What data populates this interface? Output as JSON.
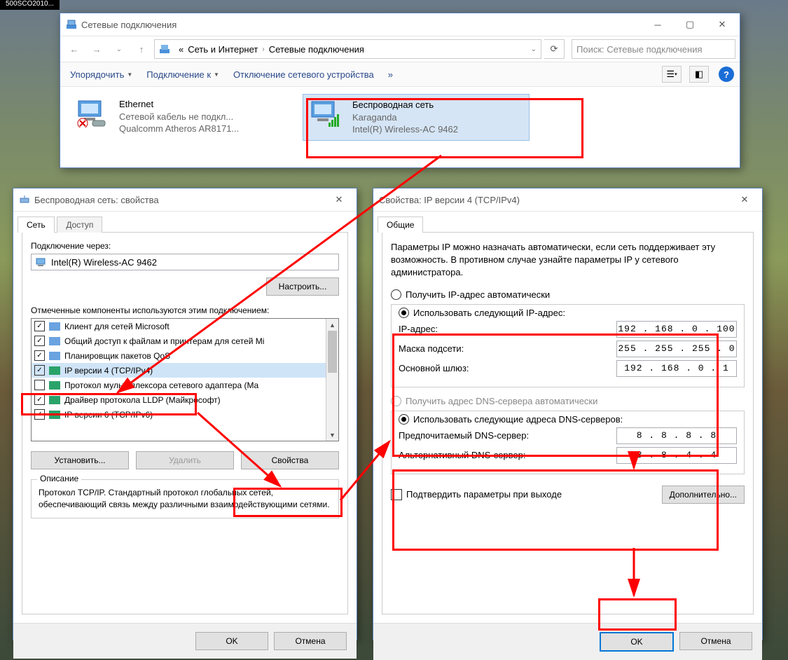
{
  "taskbar": "500SCO2010...",
  "explorer": {
    "title": "Сетевые подключения",
    "addr": {
      "root": "«",
      "p1": "Сеть и Интернет",
      "p2": "Сетевые подключения"
    },
    "search_placeholder": "Поиск: Сетевые подключения",
    "cmd": {
      "organize": "Упорядочить",
      "connect": "Подключение к",
      "disable": "Отключение сетевого устройства",
      "more": "»"
    },
    "conn": [
      {
        "name": "Ethernet",
        "status": "Сетевой кабель не подкл...",
        "adapter": "Qualcomm Atheros AR8171..."
      },
      {
        "name": "Беспроводная сеть",
        "status": "Karaganda",
        "adapter": "Intel(R) Wireless-AC 9462"
      }
    ]
  },
  "props": {
    "title": "Беспроводная сеть: свойства",
    "tabs": {
      "net": "Сеть",
      "access": "Доступ"
    },
    "conn_via_label": "Подключение через:",
    "adapter": "Intel(R) Wireless-AC 9462",
    "configure": "Настроить...",
    "components_label": "Отмеченные компоненты используются этим подключением:",
    "items": [
      "Клиент для сетей Microsoft",
      "Общий доступ к файлам и принтерам для сетей Mi",
      "Планировщик пакетов QoS",
      "IP версии 4 (TCP/IPv4)",
      "Протокол мультиплексора сетевого адаптера (Ma",
      "Драйвер протокола LLDP (Майкрософт)",
      "IP версии 6 (TCP/IPv6)"
    ],
    "item4_unchecked": true,
    "btn_install": "Установить...",
    "btn_remove": "Удалить",
    "btn_props": "Свойства",
    "desc_title": "Описание",
    "desc": "Протокол TCP/IP. Стандартный протокол глобальных сетей, обеспечивающий связь между различными взаимодействующими сетями.",
    "ok": "OK",
    "cancel": "Отмена"
  },
  "ipv4": {
    "title": "Свойства: IP версии 4 (TCP/IPv4)",
    "tab": "Общие",
    "intro": "Параметры IP можно назначать автоматически, если сеть поддерживает эту возможность. В противном случае узнайте параметры IP у сетевого администратора.",
    "r_auto_ip": "Получить IP-адрес автоматически",
    "r_use_ip": "Использовать следующий IP-адрес:",
    "l_ip": "IP-адрес:",
    "v_ip": "192 . 168 .  0  . 100",
    "l_mask": "Маска подсети:",
    "v_mask": "255 . 255 . 255 .  0",
    "l_gw": "Основной шлюз:",
    "v_gw": "192 . 168 .  0  .  1",
    "r_auto_dns": "Получить адрес DNS-сервера автоматически",
    "r_use_dns": "Использовать следующие адреса DNS-серверов:",
    "l_dns1": "Предпочитаемый DNS-сервер:",
    "v_dns1": "8  .  8  .  8  .  8",
    "l_dns2": "Альтернативный DNS-сервер:",
    "v_dns2": "8  .  8  .  4  .  4",
    "confirm": "Подтвердить параметры при выходе",
    "advanced": "Дополнительно...",
    "ok": "OK",
    "cancel": "Отмена"
  }
}
